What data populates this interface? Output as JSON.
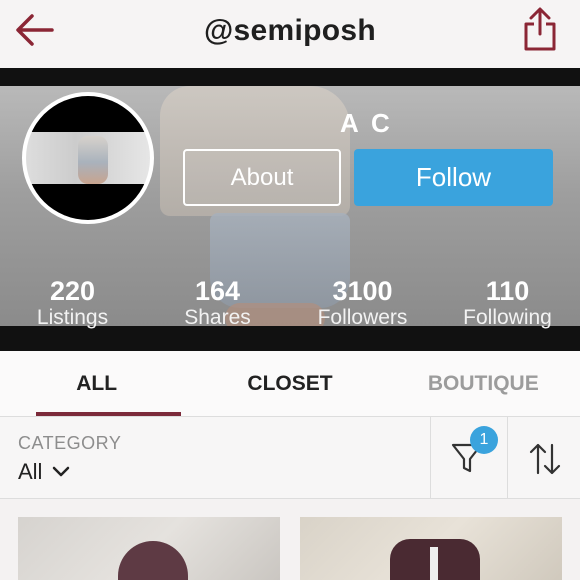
{
  "header": {
    "title": "@semiposh",
    "back_icon": "back-arrow-icon",
    "share_icon": "share-icon",
    "accent_color": "#8b2635"
  },
  "profile": {
    "name": "A C",
    "about_label": "About",
    "follow_label": "Follow",
    "follow_color": "#3aa3dd",
    "stats": [
      {
        "value": "220",
        "label": "Listings"
      },
      {
        "value": "164",
        "label": "Shares"
      },
      {
        "value": "3100",
        "label": "Followers"
      },
      {
        "value": "110",
        "label": "Following"
      }
    ]
  },
  "tabs": [
    {
      "label": "ALL",
      "active": true
    },
    {
      "label": "CLOSET",
      "active": false
    },
    {
      "label": "BOUTIQUE",
      "active": false
    }
  ],
  "filter": {
    "category_label": "CATEGORY",
    "category_value": "All",
    "filter_icon": "funnel-icon",
    "filter_badge": "1",
    "sort_icon": "sort-arrows-icon"
  },
  "listings": [
    {
      "icon": "listing-photo-hoodie"
    },
    {
      "icon": "listing-photo-jacket"
    }
  ]
}
